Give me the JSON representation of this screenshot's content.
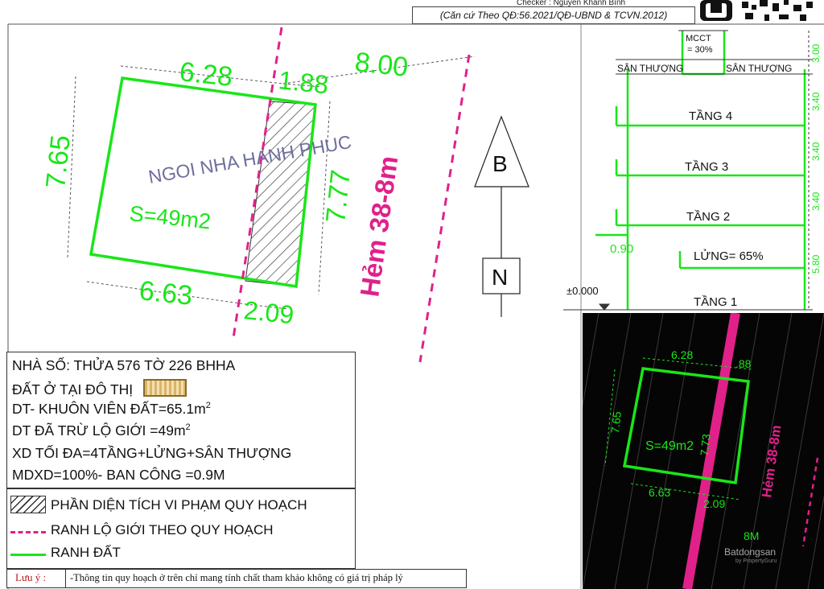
{
  "header": {
    "top_text": "Checker : Nguyễn Khánh Bình",
    "note": "(Căn cứ Theo QĐ:56.2021/QĐ-UBND & TCVN.2012)"
  },
  "plan": {
    "top_left_dim": "6.28",
    "top_right_dim": "1.88",
    "setback_dim": "8.00",
    "left_dim": "7.65",
    "right_dim": "7.77",
    "bottom_left_dim": "6.63",
    "bottom_right_dim": "2.09",
    "street_text": "NGOI NHA HANH PHUC",
    "area_label": "S=49m2",
    "alley_label": "Hẻm 38-8m"
  },
  "compass": {
    "north": "B",
    "south": "N"
  },
  "section": {
    "mcct_label": "MCCT",
    "mcct_value": "= 30%",
    "roof_left": "SÂN THƯỢNG",
    "roof_right": "SÂN THƯỢNG",
    "floors": [
      "TẦNG 4",
      "TẦNG 3",
      "TẦNG 2",
      "LỬNG= 65%",
      "TẦNG 1"
    ],
    "heights": [
      "3.00",
      "3.40",
      "3.40",
      "3.40",
      "5.80"
    ],
    "balcony": "0.90",
    "level_zero": "±0.000"
  },
  "info": {
    "lot": "NHÀ SỐ: THỬA 576 TỜ 226 BHHA",
    "land_type": "ĐẤT Ở TẠI ĐÔ THỊ",
    "area_total": "DT- KHUÔN VIÊN ĐẤT=65.1m",
    "area_net": "DT ĐÃ TRỪ LỘ GIỚI =49m",
    "sup": "2",
    "max_build": "XD TỐI ĐA=4TẦNG+LỬNG+SÂN THƯỢNG",
    "density": "MDXD=100%- BAN CÔNG =0.9M"
  },
  "legend": {
    "violation": "PHẦN DIỆN TÍCH VI PHẠM QUY HOẠCH",
    "road_line": "RANH LỘ GIỚI THEO QUY HOẠCH",
    "land_line": "RANH ĐẤT"
  },
  "note": {
    "title": "Lưu ý :",
    "text": "-Thông tin quy hoạch ở trên chỉ mang tính chất tham khảo không có giá trị pháp lý"
  },
  "photo": {
    "dim_top_left": "6.28",
    "dim_top_right": ".88",
    "dim_left": "7.65",
    "dim_right": "7.73",
    "area": "S=49m2",
    "dim_bottom_left": "6.63",
    "dim_bottom_right": "2.09",
    "alley": "Hẻm 38-8m",
    "width_label": "8M",
    "watermark": "Batdongsan",
    "watermark_sub": "by PropertyGuru"
  },
  "colors": {
    "land_green": "#19e619",
    "magenta": "#e0218a",
    "line_dark": "#222222",
    "photo_bg": "#050505"
  }
}
